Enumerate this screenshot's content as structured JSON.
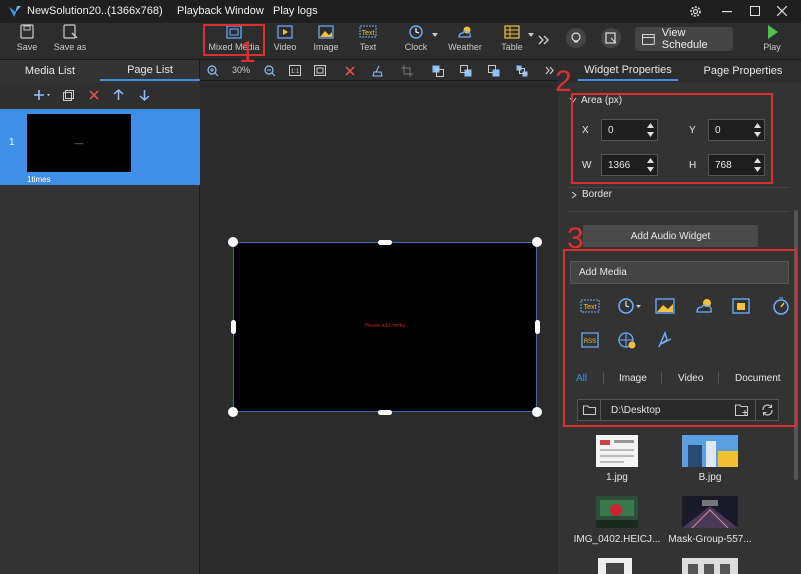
{
  "titlebar": {
    "app_name": "NewSolution20...",
    "resolution": "(1366x768)",
    "menu_playback": "Playback Window",
    "menu_logs": "Play logs"
  },
  "toolbar": {
    "save": "Save",
    "save_as": "Save as",
    "mixed_media": "Mixed Media",
    "video": "Video",
    "image": "Image",
    "text": "Text",
    "clock": "Clock",
    "weather": "Weather",
    "table": "Table",
    "view_schedule": "View Schedule",
    "play": "Play"
  },
  "left_panel": {
    "tab_media": "Media List",
    "tab_page": "Page List",
    "page_index": "1",
    "page_thumb_text": "—",
    "page_times": "1times"
  },
  "canvas": {
    "zoom": "30%",
    "placeholder_text": "Please add media"
  },
  "right_panel": {
    "tab_widget": "Widget Properties",
    "tab_page": "Page Properties",
    "area_label": "Area (px)",
    "x_label": "X",
    "x_value": "0",
    "y_label": "Y",
    "y_value": "0",
    "w_label": "W",
    "w_value": "1366",
    "h_label": "H",
    "h_value": "768",
    "border_label": "Border",
    "add_audio": "Add Audio Widget",
    "add_media": "Add Media",
    "filter_all": "All",
    "filter_image": "Image",
    "filter_video": "Video",
    "filter_document": "Document",
    "path": "D:\\Desktop",
    "files": [
      "1.jpg",
      "B.jpg",
      "IMG_0402.HEICJ...",
      "Mask-Group-557..."
    ]
  },
  "annotations": {
    "n1": "1",
    "n2": "2",
    "n3": "3"
  },
  "colors": {
    "accent": "#3d8fe8",
    "highlight": "#d93030",
    "selected_page": "#3d8fe8"
  }
}
